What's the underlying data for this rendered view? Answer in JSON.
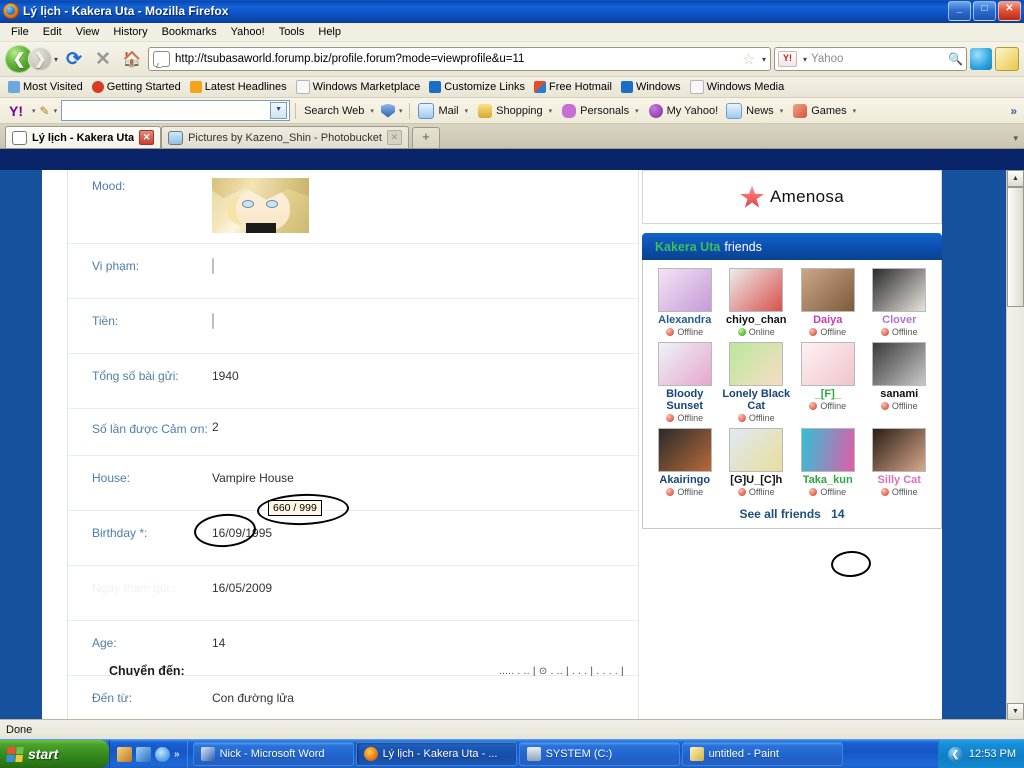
{
  "window": {
    "title": "Lý lịch - Kakera Uta - Mozilla Firefox",
    "minimize": "_",
    "maximize": "□",
    "close": "✕"
  },
  "menu": {
    "items": [
      "File",
      "Edit",
      "View",
      "History",
      "Bookmarks",
      "Yahoo!",
      "Tools",
      "Help"
    ]
  },
  "nav": {
    "back": "❮",
    "forward": "❯",
    "dropdown": "▾",
    "reload": "⟳",
    "stop": "✕",
    "home": "🏠",
    "url": "http://tsubasaworld.forump.biz/profile.forum?mode=viewprofile&u=11",
    "star": "☆",
    "url_dropdown": "▾",
    "search_placeholder": "Yahoo",
    "search_value": "",
    "search_icon": "search-icon"
  },
  "bookmarks": {
    "items": [
      {
        "label": "Most Visited",
        "color": "#6da7dd"
      },
      {
        "label": "Getting Started",
        "color": "#d83a22"
      },
      {
        "label": "Latest Headlines",
        "color": "#f5a31a"
      },
      {
        "label": "Windows Marketplace",
        "color": "#f2f2f2"
      },
      {
        "label": "Customize Links",
        "color": "#1a6fc4"
      },
      {
        "label": "Free Hotmail",
        "color": "#2a7bd4"
      },
      {
        "label": "Windows",
        "color": "#1a6fc4"
      },
      {
        "label": "Windows Media",
        "color": "#f2f2f2"
      }
    ]
  },
  "yahoo_toolbar": {
    "logo": "Y!",
    "input_value": "",
    "items": [
      {
        "label": "Search Web",
        "color": "#3a73c4",
        "has_arrow": true
      },
      {
        "label": "Mail",
        "color": "#7fb6e8",
        "has_arrow": true
      },
      {
        "label": "Shopping",
        "color": "#e8c24a",
        "has_arrow": true
      },
      {
        "label": "Personals",
        "color": "#c86fd4",
        "has_arrow": true
      },
      {
        "label": "My Yahoo!",
        "color": "#7b2a9e",
        "has_arrow": false
      },
      {
        "label": "News",
        "color": "#9fc9ec",
        "has_arrow": true
      },
      {
        "label": "Games",
        "color": "#e0705c",
        "has_arrow": true
      }
    ],
    "overflow": "»"
  },
  "tabs": {
    "items": [
      {
        "label": "Lý lịch - Kakera Uta",
        "active": true,
        "close": "✕"
      },
      {
        "label": "Pictures by Kazeno_Shin - Photobucket",
        "active": false,
        "close": "✕"
      }
    ],
    "new_tab": "+",
    "list_all": "▾"
  },
  "profile": {
    "rows": [
      {
        "label": "Mood:",
        "type": "avatar",
        "value": ""
      },
      {
        "label": "Vi phạm:",
        "type": "bar",
        "value": "",
        "percent": 0
      },
      {
        "label": "Tiền:",
        "type": "bar",
        "value": "",
        "percent": 66
      },
      {
        "label": "Tổng số bài gửi:",
        "type": "text",
        "value": "1940"
      },
      {
        "label": "Số lần được Cảm ơn:",
        "type": "text",
        "value": "2"
      },
      {
        "label": "House:",
        "type": "text",
        "value": "Vampire House"
      },
      {
        "label": "Birthday *:",
        "type": "text",
        "value": "16/09/1995"
      },
      {
        "label": "Ngày tham gia :",
        "type": "text",
        "value": "16/05/2009",
        "faded": true
      },
      {
        "label": "Age:",
        "type": "text",
        "value": "14"
      },
      {
        "label": "Đến từ:",
        "type": "text",
        "value": "Con đường lửa"
      }
    ],
    "bottom_label": "Chuyển đến:",
    "bottom_links": "..... . .. | ⊙ . .. | . . . | . . . . |"
  },
  "annotations": {
    "money_tooltip": "660 / 999",
    "circled_posts": "1940",
    "circled_friends_count": "14"
  },
  "sidebar": {
    "ad_text": "Amenosa",
    "friends_panel": {
      "owner": "Kakera Uta",
      "title_rest": "friends",
      "see_all_label": "See all friends",
      "see_all_count": "14",
      "friends": [
        {
          "name": "Alexandra",
          "status": "Offline",
          "online": false,
          "color": "#1f5d8e",
          "img1": "#f3e4f6",
          "img2": "#c59ad6"
        },
        {
          "name": "chiyo_chan",
          "status": "Online",
          "online": true,
          "color": "#111111",
          "img1": "#ececec",
          "img2": "#d7524c"
        },
        {
          "name": "Daiya",
          "status": "Offline",
          "online": false,
          "color": "#c43fb0",
          "img1": "#caa888",
          "img2": "#7e5a3c"
        },
        {
          "name": "Clover",
          "status": "Offline",
          "online": false,
          "color": "#b46fd8",
          "img1": "#2a2a2a",
          "img2": "#e8e4dd"
        },
        {
          "name": "Bloody Sunset",
          "status": "Offline",
          "online": false,
          "color": "#17457a",
          "img1": "#eef3f8",
          "img2": "#e6a6cd"
        },
        {
          "name": "Lonely Black Cat",
          "status": "Offline",
          "online": false,
          "color": "#17457a",
          "img1": "#b9e89a",
          "img2": "#f7dcc6"
        },
        {
          "name": "_[F]_",
          "status": "Offline",
          "online": false,
          "color": "#2fa83f",
          "img1": "#fdf2f2",
          "img2": "#f0c4cc"
        },
        {
          "name": "sanami",
          "status": "Offline",
          "online": false,
          "color": "#111111",
          "img1": "#3a3a3a",
          "img2": "#c9c9c9"
        },
        {
          "name": "Akairingo",
          "status": "Offline",
          "online": false,
          "color": "#17457a",
          "img1": "#2b2b2b",
          "img2": "#b8693a"
        },
        {
          "name": "[G]U_[C]h",
          "status": "Offline",
          "online": false,
          "color": "#111111",
          "img1": "#dfeaf5",
          "img2": "#e9dd9a"
        },
        {
          "name": "Taka_kun",
          "status": "Offline",
          "online": false,
          "color": "#2fa83f",
          "img1": "#33c0d6",
          "img2": "#e05ca8"
        },
        {
          "name": "Silly Cat",
          "status": "Offline",
          "online": false,
          "color": "#e06fb8",
          "img1": "#2b1d16",
          "img2": "#d8a98a"
        }
      ]
    }
  },
  "statusbar": {
    "text": "Done"
  },
  "taskbar": {
    "start_label": "start",
    "quick_launch": [
      {
        "name": "media-player-icon",
        "color": "#d8a13a"
      },
      {
        "name": "windows-media-icon",
        "color": "#3a7fd8"
      },
      {
        "name": "internet-explorer-icon",
        "color": "#1a7ed4"
      }
    ],
    "quick_overflow": "»",
    "tasks": [
      {
        "label": "Nick - Microsoft Word",
        "icon_color": "#2a5fae",
        "active": false
      },
      {
        "label": "Lý lịch - Kakera Uta - ...",
        "icon_color": "#e8751a",
        "active": true
      },
      {
        "label": "SYSTEM (C:)",
        "icon_color": "#b9c6d6",
        "active": false
      },
      {
        "label": "untitled - Paint",
        "icon_color": "#e8d35a",
        "active": false
      }
    ],
    "tray_chevron": "❮",
    "clock": "12:53 PM"
  }
}
